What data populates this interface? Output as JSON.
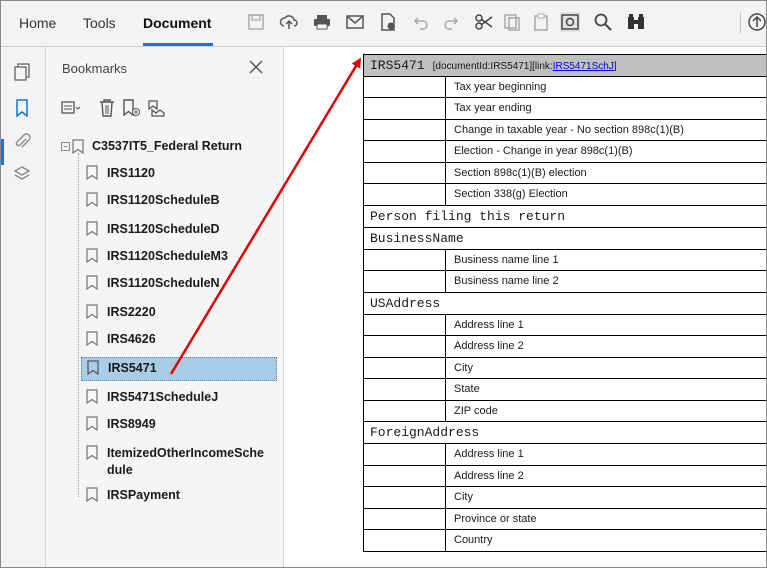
{
  "toolbar": {
    "tabs": [
      "Home",
      "Tools",
      "Document"
    ],
    "active_tab": "Document",
    "icons": [
      "save-icon",
      "upload-icon",
      "print-icon",
      "email-icon",
      "protect-icon",
      "undo-icon",
      "redo-icon",
      "cut-icon",
      "copy-icon",
      "paste-icon",
      "snapshot-icon",
      "search-icon",
      "find-icon",
      "share-icon"
    ]
  },
  "rail": {
    "icons": [
      "pages-icon",
      "bookmark-icon",
      "attachment-icon",
      "layers-icon"
    ]
  },
  "bookmarks": {
    "title": "Bookmarks",
    "root": "C3537IT5_Federal Return",
    "items": [
      "IRS1120",
      "IRS1120ScheduleB",
      "IRS1120ScheduleD",
      "IRS1120ScheduleM3",
      "IRS1120ScheduleN",
      "IRS2220",
      "IRS4626",
      "IRS5471",
      "IRS5471ScheduleJ",
      "IRS8949",
      "ItemizedOtherIncomeSche",
      "dule",
      "IRSPayment"
    ],
    "selected": "IRS5471"
  },
  "document": {
    "header_title": "IRS5471",
    "header_meta_prefix": "[documentId:IRS5471][link:",
    "header_link": "IRS5471SchJ",
    "header_meta_suffix": "]",
    "rows": [
      {
        "type": "field",
        "label": "Tax year beginning"
      },
      {
        "type": "field",
        "label": "Tax year ending"
      },
      {
        "type": "field",
        "label": "Change in taxable year - No section 898c(1)(B)"
      },
      {
        "type": "field",
        "label": "Election - Change in year 898c(1)(B)"
      },
      {
        "type": "field",
        "label": "Section 898c(1)(B) election"
      },
      {
        "type": "field",
        "label": "Section 338(g) Election"
      },
      {
        "type": "section",
        "label": "Person filing this return"
      },
      {
        "type": "section",
        "label": "BusinessName"
      },
      {
        "type": "field",
        "label": "Business name line 1"
      },
      {
        "type": "field",
        "label": "Business name line 2"
      },
      {
        "type": "section",
        "label": "USAddress"
      },
      {
        "type": "field",
        "label": "Address line 1"
      },
      {
        "type": "field",
        "label": "Address line 2"
      },
      {
        "type": "field",
        "label": "City"
      },
      {
        "type": "field",
        "label": "State"
      },
      {
        "type": "field",
        "label": "ZIP code"
      },
      {
        "type": "section",
        "label": "ForeignAddress"
      },
      {
        "type": "field",
        "label": "Address line 1"
      },
      {
        "type": "field",
        "label": "Address line 2"
      },
      {
        "type": "field",
        "label": "City"
      },
      {
        "type": "field",
        "label": "Province or state"
      },
      {
        "type": "field",
        "label": "Country"
      }
    ]
  },
  "colors": {
    "accent": "#1473e6",
    "selection": "#a9cce7",
    "arrow": "#e00000",
    "header_gray": "#c0c0c0"
  }
}
